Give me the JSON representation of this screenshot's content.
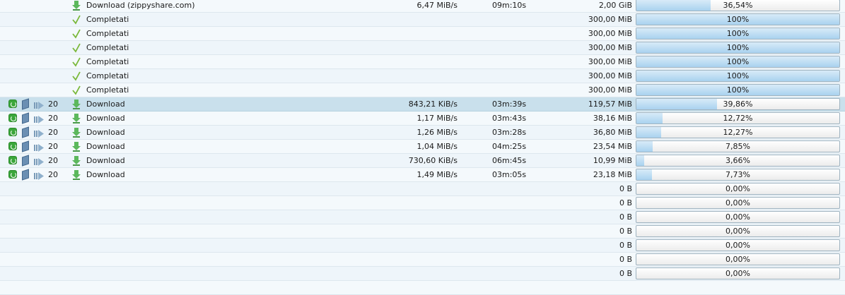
{
  "rows": [
    {
      "icons": false,
      "prio": "",
      "status_icon": "download-arrow-icon",
      "status": "Download (zippyshare.com)",
      "speed": "6,47 MiB/s",
      "eta": "09m:10s",
      "size": "2,00 GiB",
      "progress_label": "36,54%",
      "progress": 0.3654
    },
    {
      "icons": false,
      "prio": "",
      "status_icon": "checkmark-icon",
      "status": "Completati",
      "speed": "",
      "eta": "",
      "size": "300,00 MiB",
      "progress_label": "100%",
      "progress": 1.0
    },
    {
      "icons": false,
      "prio": "",
      "status_icon": "checkmark-icon",
      "status": "Completati",
      "speed": "",
      "eta": "",
      "size": "300,00 MiB",
      "progress_label": "100%",
      "progress": 1.0
    },
    {
      "icons": false,
      "prio": "",
      "status_icon": "checkmark-icon",
      "status": "Completati",
      "speed": "",
      "eta": "",
      "size": "300,00 MiB",
      "progress_label": "100%",
      "progress": 1.0
    },
    {
      "icons": false,
      "prio": "",
      "status_icon": "checkmark-icon",
      "status": "Completati",
      "speed": "",
      "eta": "",
      "size": "300,00 MiB",
      "progress_label": "100%",
      "progress": 1.0
    },
    {
      "icons": false,
      "prio": "",
      "status_icon": "checkmark-icon",
      "status": "Completati",
      "speed": "",
      "eta": "",
      "size": "300,00 MiB",
      "progress_label": "100%",
      "progress": 1.0
    },
    {
      "icons": false,
      "prio": "",
      "status_icon": "checkmark-icon",
      "status": "Completati",
      "speed": "",
      "eta": "",
      "size": "300,00 MiB",
      "progress_label": "100%",
      "progress": 1.0
    },
    {
      "icons": true,
      "prio": "20",
      "status_icon": "download-arrow-icon",
      "status": "Download",
      "speed": "843,21 KiB/s",
      "eta": "03m:39s",
      "size": "119,57 MiB",
      "progress_label": "39,86%",
      "progress": 0.3986,
      "selected": true
    },
    {
      "icons": true,
      "prio": "20",
      "status_icon": "download-arrow-icon",
      "status": "Download",
      "speed": "1,17 MiB/s",
      "eta": "03m:43s",
      "size": "38,16 MiB",
      "progress_label": "12,72%",
      "progress": 0.1272
    },
    {
      "icons": true,
      "prio": "20",
      "status_icon": "download-arrow-icon",
      "status": "Download",
      "speed": "1,26 MiB/s",
      "eta": "03m:28s",
      "size": "36,80 MiB",
      "progress_label": "12,27%",
      "progress": 0.1227
    },
    {
      "icons": true,
      "prio": "20",
      "status_icon": "download-arrow-icon",
      "status": "Download",
      "speed": "1,04 MiB/s",
      "eta": "04m:25s",
      "size": "23,54 MiB",
      "progress_label": "7,85%",
      "progress": 0.0785
    },
    {
      "icons": true,
      "prio": "20",
      "status_icon": "download-arrow-icon",
      "status": "Download",
      "speed": "730,60 KiB/s",
      "eta": "06m:45s",
      "size": "10,99 MiB",
      "progress_label": "3,66%",
      "progress": 0.0366
    },
    {
      "icons": true,
      "prio": "20",
      "status_icon": "download-arrow-icon",
      "status": "Download",
      "speed": "1,49 MiB/s",
      "eta": "03m:05s",
      "size": "23,18 MiB",
      "progress_label": "7,73%",
      "progress": 0.0773
    },
    {
      "icons": false,
      "prio": "",
      "status_icon": "",
      "status": "",
      "speed": "",
      "eta": "",
      "size": "0 B",
      "progress_label": "0,00%",
      "progress": 0
    },
    {
      "icons": false,
      "prio": "",
      "status_icon": "",
      "status": "",
      "speed": "",
      "eta": "",
      "size": "0 B",
      "progress_label": "0,00%",
      "progress": 0
    },
    {
      "icons": false,
      "prio": "",
      "status_icon": "",
      "status": "",
      "speed": "",
      "eta": "",
      "size": "0 B",
      "progress_label": "0,00%",
      "progress": 0
    },
    {
      "icons": false,
      "prio": "",
      "status_icon": "",
      "status": "",
      "speed": "",
      "eta": "",
      "size": "0 B",
      "progress_label": "0,00%",
      "progress": 0
    },
    {
      "icons": false,
      "prio": "",
      "status_icon": "",
      "status": "",
      "speed": "",
      "eta": "",
      "size": "0 B",
      "progress_label": "0,00%",
      "progress": 0
    },
    {
      "icons": false,
      "prio": "",
      "status_icon": "",
      "status": "",
      "speed": "",
      "eta": "",
      "size": "0 B",
      "progress_label": "0,00%",
      "progress": 0
    },
    {
      "icons": false,
      "prio": "",
      "status_icon": "",
      "status": "",
      "speed": "",
      "eta": "",
      "size": "0 B",
      "progress_label": "0,00%",
      "progress": 0
    },
    {
      "icons": false,
      "prio": "",
      "status_icon": "",
      "status": "",
      "speed": "",
      "eta": "",
      "size": "",
      "progress_label": "",
      "progress": null
    }
  ],
  "colors": {
    "download_icon": "#5cb85c",
    "check_icon": "#7ab83a",
    "progress_fill": "#a9d2ef",
    "selected_row": "#c9e0ec"
  }
}
